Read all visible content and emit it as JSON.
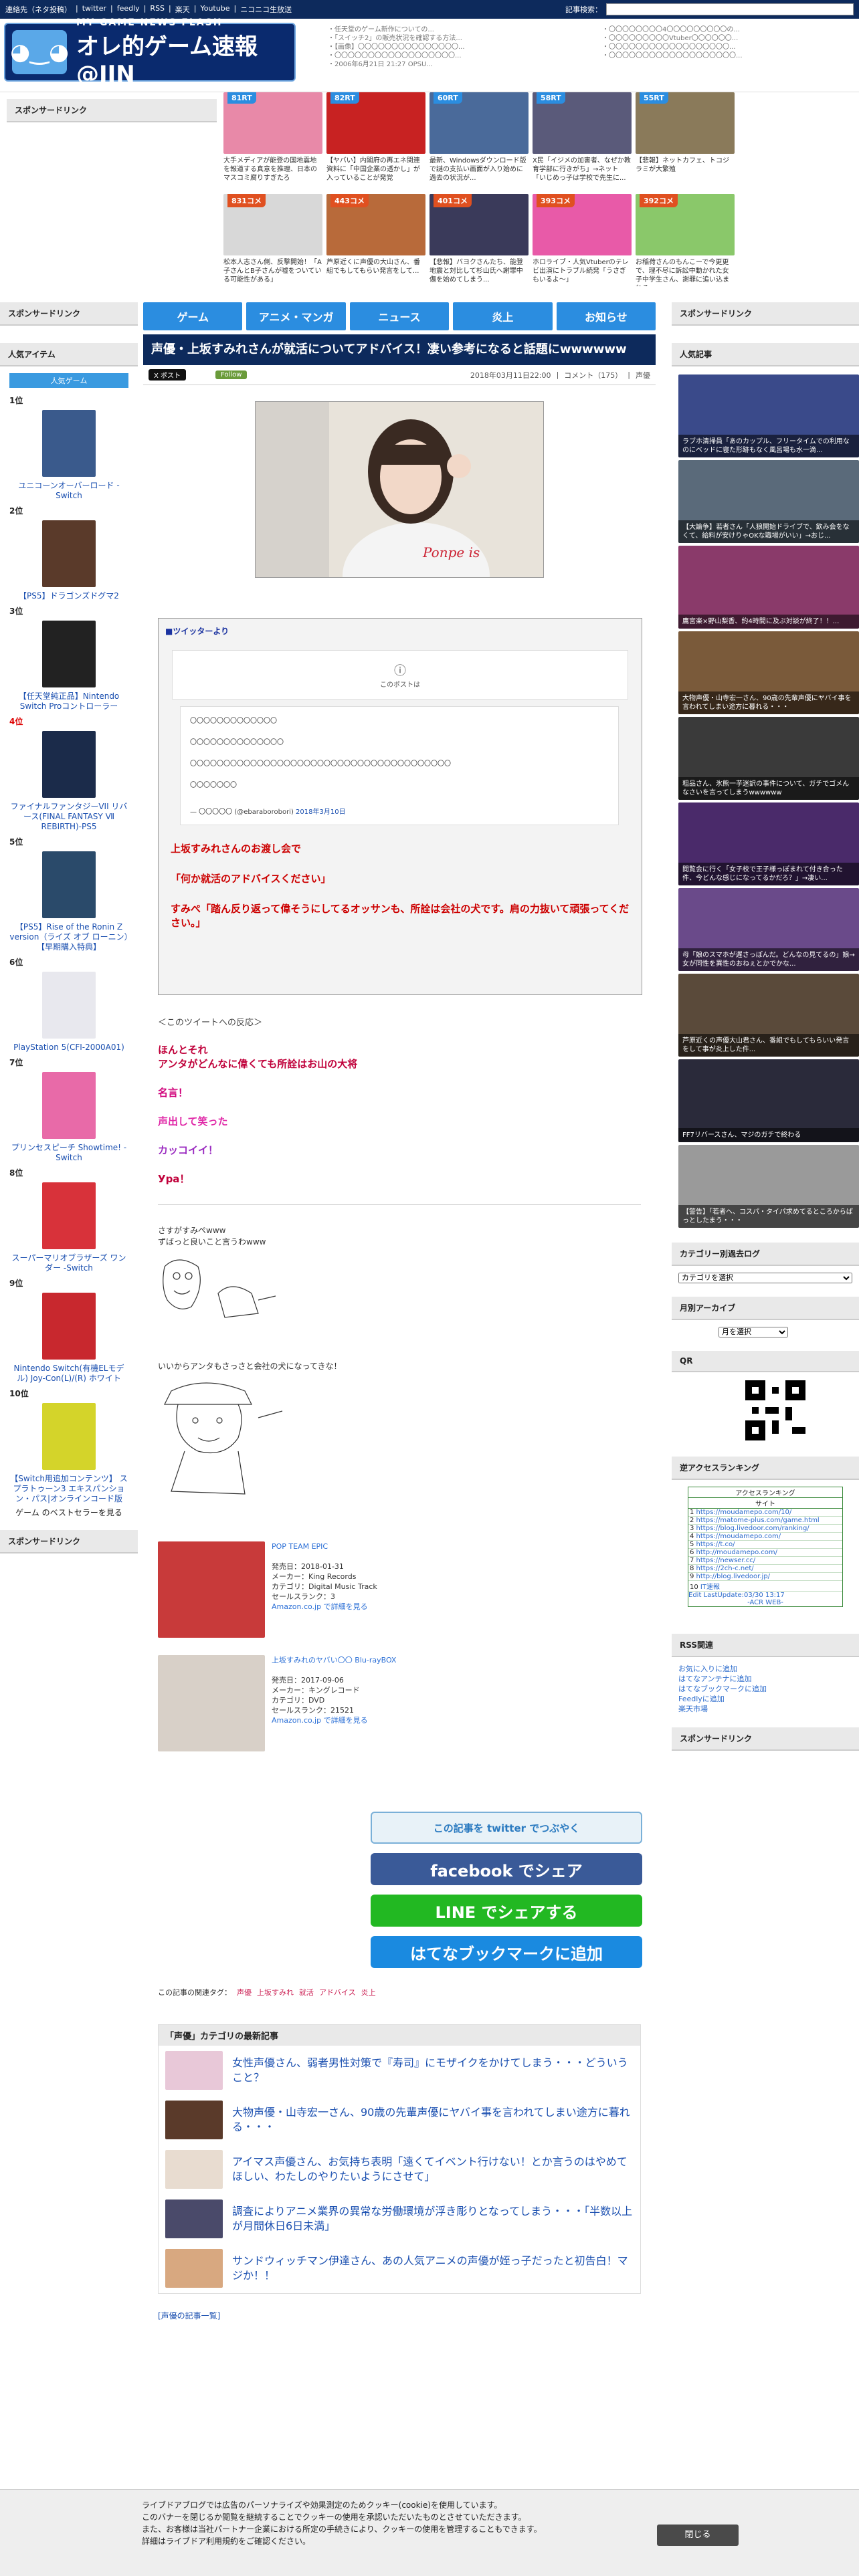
{
  "topbar": {
    "links": [
      "連絡先（ネタ投稿）",
      "twitter",
      "feedly",
      "RSS",
      "楽天",
      "Youtube",
      "ニコニコ生放送"
    ],
    "search_label": "記事検索："
  },
  "logo": {
    "sub": "MY GAME NEWS FLASH",
    "main": "オレ的ゲーム速報@JIN"
  },
  "header_list_a": [
    "任天堂のゲーム新作についての...",
    "「スイッチ2」の販売状況を確認する方法...",
    "【画像】〇〇〇〇〇〇〇〇〇〇〇〇〇〇〇...",
    "〇〇〇〇〇〇〇〇〇〇〇〇〇〇〇〇〇〇...",
    "2006年6月21日 21:27 OPSU..."
  ],
  "header_list_b": [
    "〇〇〇〇〇〇〇〇4〇〇〇〇〇〇〇〇〇の...",
    "〇〇〇〇〇〇〇〇〇Vtuber〇〇〇〇〇〇...",
    "〇〇〇〇〇〇〇〇〇〇〇〇〇〇〇〇〇〇...",
    "〇〇〇〇〇〇〇〇〇〇〇〇〇〇〇〇〇〇〇..."
  ],
  "left": {
    "sponsor_title": "スポンサードリンク",
    "popular_title": "人気アイテム",
    "popular_button": "人気ゲーム",
    "items": [
      {
        "rank": "1位",
        "name": "ユニコーンオーバーロード -Switch",
        "color": "#3a5a8c"
      },
      {
        "rank": "2位",
        "name": "【PS5】ドラゴンズドグマ2",
        "color": "#5a3a2a"
      },
      {
        "rank": "3位",
        "name": "【任天堂純正品】Nintendo Switch Proコントローラー",
        "color": "#222222"
      },
      {
        "rank": "4位",
        "name": "ファイナルファンタジーVII リバース(FINAL FANTASY Ⅶ REBIRTH)-PS5",
        "color": "#1b2b4a"
      },
      {
        "rank": "5位",
        "name": "【PS5】Rise of the Ronin Z version（ライズ オブ ローニン）【早期購入特典】",
        "color": "#2a4a6a"
      },
      {
        "rank": "6位",
        "name": "PlayStation 5(CFI-2000A01)",
        "color": "#e8e8ee"
      },
      {
        "rank": "7位",
        "name": "プリンセスピーチ Showtime! -Switch",
        "color": "#e86aa8"
      },
      {
        "rank": "8位",
        "name": "スーパーマリオブラザーズ ワンダー -Switch",
        "color": "#d8323a"
      },
      {
        "rank": "9位",
        "name": "Nintendo Switch(有機ELモデル) Joy-Con(L)/(R) ホワイト",
        "color": "#c8282e"
      },
      {
        "rank": "10位",
        "name": "【Switch用追加コンテンツ】 スプラトゥーン3 エキスパンション・パス|オンラインコード版",
        "color": "#d4d42a"
      }
    ],
    "ranking_link": "ゲーム のベストセラーを見る",
    "sponsor_title2": "スポンサードリンク"
  },
  "thumbs": [
    {
      "badge": "81RT",
      "caption": "大手メディアが能登の国地震地を報道する真意を推理、日本のマスコミ腐りすぎたろ",
      "color": "#e889a8"
    },
    {
      "badge": "82RT",
      "caption": "【ヤバい】内閣府の再エネ関連資料に「中国企業の透かし」が入っていることが発覚",
      "color": "#c82222"
    },
    {
      "badge": "60RT",
      "caption": "最新、Windowsダウンロード版で謎の支払い画面が入り始めに過去の状況が...",
      "color": "#4a6a9a"
    },
    {
      "badge": "58RT",
      "caption": "X民「イジメの加害者、なぜか教育学部に行きがち」→ネット「いじめっ子は学校で先生に...",
      "color": "#5a5a7a"
    },
    {
      "badge": "55RT",
      "caption": "【悲報】ネットカフェ、トコジラミが大繁殖",
      "color": "#8a7a5a"
    },
    {
      "badge": "831コメ",
      "caption": "松本人志さん側、反撃開始！「A子さんとB子さんが嘘をついている可能性がある」",
      "color": "#d8d8d8"
    },
    {
      "badge": "443コメ",
      "caption": "芦原近くに声優の大山さん、番組でもしてもらい発言をして...",
      "color": "#b86a3a"
    },
    {
      "badge": "401コメ",
      "caption": "【悲報】バヨクさんたち、能登地震と対比して杉山氏へ謝罪中傷を始めてしまう...",
      "color": "#3a3a5a"
    },
    {
      "badge": "393コメ",
      "caption": "ホロライブ・人気Vtuberのテレビ出演にトラブル続発「うさぎもいるよ〜」",
      "color": "#e85aa8"
    },
    {
      "badge": "392コメ",
      "caption": "お稲荷さんのもんこーで今更更で、理不尽に訴訟中動かれた女子中学生さん、謝罪に追い込まれる",
      "color": "#8ac86a"
    }
  ],
  "nav": [
    "ゲーム",
    "アニメ・マンガ",
    "ニュース",
    "炎上",
    "お知らせ"
  ],
  "article": {
    "title": "声優・上坂すみれさんが就活についてアドバイス！凄い参考になると話題にwwwwww",
    "x_button": "X ポスト",
    "follow_button": "Follow",
    "date": "2018年03月11日22:00",
    "comments": "コメント（175）",
    "category": "声優",
    "tweet_from": "■ツイッターより",
    "tweet_warning": "このポストは",
    "tweet_lines": [
      "〇〇〇〇〇〇〇〇〇〇〇〇〇",
      "〇〇〇〇〇〇〇〇〇〇〇〇〇〇",
      "〇〇〇〇〇〇〇〇〇〇〇〇〇〇〇〇〇〇〇〇〇〇〇〇〇〇〇〇〇〇〇〇〇〇〇〇〇〇〇",
      "〇〇〇〇〇〇〇"
    ],
    "tweet_author": "— 〇〇〇〇〇 (@ebaraborobori)",
    "tweet_date": "2018年3月10日",
    "red_lines": [
      "上坂すみれさんのお渡し会で",
      "「何か就活のアドバイスください」",
      "すみぺ「踏ん反り返って偉そうにしてるオッサンも、所詮は会社の犬です。肩の力抜いて頑張ってください。」"
    ],
    "reaction_header": "＜このツイートへの反応＞",
    "reactions": [
      {
        "text": "ほんとそれ\nアンタがどんなに偉くても所詮はお山の大将",
        "color": "#c0003a"
      },
      {
        "text": "名言！",
        "color": "#d0007a"
      },
      {
        "text": "声出して笑った",
        "color": "#e02aa8"
      },
      {
        "text": "カッコイイ！",
        "color": "#9a2ac0"
      },
      {
        "text": "Ура！",
        "color": "#c0003a"
      }
    ],
    "aa1": [
      "さすがすみぺwww",
      "ずばっと良いこと言うわwww"
    ],
    "aa2": "いいからアンタもさっさと会社の犬になってきな！",
    "products": [
      {
        "title": "POP TEAM EPIC",
        "lines": [
          "発売日：2018-01-31",
          "メーカー：King Records",
          "カテゴリ：Digital Music Track",
          "セールスランク：3"
        ],
        "link": "Amazon.co.jp で詳細を見る",
        "color": "#c83a3a"
      },
      {
        "title": "上坂すみれのヤバい〇〇 Blu-rayBOX",
        "lines": [
          "発売日：2017-09-06",
          "メーカー：キングレコード",
          "カテゴリ：DVD",
          "セールスランク：21521"
        ],
        "link": "Amazon.co.jp で詳細を見る",
        "color": "#d8d0c8"
      }
    ],
    "share": [
      {
        "label": "この記事を twitter でつぶやく",
        "color": "#e8f2f8",
        "fg": "#2a7ac0"
      },
      {
        "label": "facebook でシェア",
        "color": "#3a5a98",
        "fg": "#ffffff"
      },
      {
        "label": "LINE でシェアする",
        "color": "#22b822",
        "fg": "#ffffff"
      },
      {
        "label": "はてなブックマークに追加",
        "color": "#1a8ae0",
        "fg": "#ffffff"
      }
    ],
    "tags_label": "この記事の関連タグ：",
    "tags": [
      "声優",
      "上坂すみれ",
      "就活",
      "アドバイス",
      "炎上"
    ],
    "latest_header": "「声優」カテゴリの最新記事",
    "latest": [
      {
        "title": "女性声優さん、弱者男性対策で『寿司』にモザイクをかけてしまう・・・どういうこと？",
        "color": "#e8c8d8"
      },
      {
        "title": "大物声優・山寺宏一さん、90歳の先輩声優にヤバイ事を言われてしまい途方に暮れる・・・",
        "color": "#5a3a2a"
      },
      {
        "title": "アイマス声優さん、お気持ち表明「遠くてイベント行けない！とか言うのはやめてほしい、わたしのやりたいようにさせて」",
        "color": "#e8dcd0"
      },
      {
        "title": "調査によりアニメ業界の異常な労働環境が浮き彫りとなってしまう・・・「半数以上が月間休日6日未満」",
        "color": "#4a4a6a"
      },
      {
        "title": "サンドウィッチマン伊達さん、あの人気アニメの声優が姪っ子だったと初告白！マジか！！",
        "color": "#d8a880"
      }
    ],
    "more_link": "[声優の記事一覧]"
  },
  "right": {
    "sponsor_title": "スポンサードリンク",
    "popular_title": "人気記事",
    "popular": [
      {
        "caption": "ラブホ清掃員「あのカップル、フリータイムでの利用なのにベッドに寝た形跡もなく風呂場も水一滴...",
        "color": "#3a4a8a"
      },
      {
        "caption": "【大論争】若者さん「人狼開始ドライブで、飲み会をなくて、給料が安けりゃOKな職場がいい」→おじ...",
        "color": "#5a6a7a"
      },
      {
        "caption": "鷹宮楽×野山梨香、約4時間に及ぶ対談が終了！！...",
        "color": "#8a3a6a"
      },
      {
        "caption": "大物声優・山寺宏一さん、90歳の先輩声優にヤバイ事を言われてしまい途方に暮れる・・・",
        "color": "#7a5a3a"
      },
      {
        "caption": "粗品さん、氷熊一芋迷訳の事件について、ガチでゴメんなさいを言ってしまうwwwwww",
        "color": "#3a3a3a"
      },
      {
        "caption": "閲覧会に行く「女子校で王子様っぽまれて付き合った件、今どんな感じになってるかだろ？」→凄い...",
        "color": "#4a2a6a"
      },
      {
        "caption": "母「娘のスマホが遅さっぽんだ。どんなの見てるの」娘→女が同性を異性のおねぇとかでかな...",
        "color": "#6a4a8a"
      },
      {
        "caption": "芦原近くの声優大山君さん、番組でもしてもらいい発言をして事が炎上した件...",
        "color": "#5a4a3a"
      },
      {
        "caption": "FF7リバースさん、マジのガチで終わる",
        "color": "#2a2a3a"
      },
      {
        "caption": "【警告】「若者へ、コスパ・タイパ求めてるところからぱっとしたまう・・・",
        "color": "#9a9a9a"
      }
    ],
    "category_title": "カテゴリー別過去ログ",
    "category_select": "カテゴリを選択",
    "archive_title": "月別アーカイブ",
    "archive_select": "月を選択",
    "qr_title": "QR",
    "access_title": "逆アクセスランキング",
    "access_header": "アクセスランキング",
    "access_sub": "サイト",
    "access_rows": [
      "https://moudamepo.com/10/",
      "https://matome-plus.com/game.html",
      "https://blog.livedoor.com/ranking/",
      "https://moudamepo.com/",
      "https://t.co/",
      "http://moudamepo.com/",
      "https://newser.cc/",
      "https://2ch-c.net/",
      "http://blog.livedoor.jp/",
      "IT速報"
    ],
    "access_update": "Edit LastUpdate:03/30 13:17",
    "access_acr": "-ACR WEB-",
    "rss_title": "RSS関連",
    "rss_links": [
      "お気に入りに追加",
      "はてなアンテナに追加",
      "はてなブックマークに追加",
      "Feedlyに追加",
      "楽天市場"
    ],
    "sponsor_title2": "スポンサードリンク"
  },
  "cookie": {
    "lines": [
      "ライブドアブログでは広告のパーソナライズや効果測定のためクッキー(cookie)を使用しています。",
      "このバナーを閉じるか閲覧を継続することでクッキーの使用を承認いただいたものとさせていただきます。",
      "また、お客様は当社パートナー企業における所定の手続きにより、クッキーの使用を管理することもできます。",
      "詳細はライブドア利用規約をご確認ください。"
    ],
    "close": "閉じる"
  }
}
